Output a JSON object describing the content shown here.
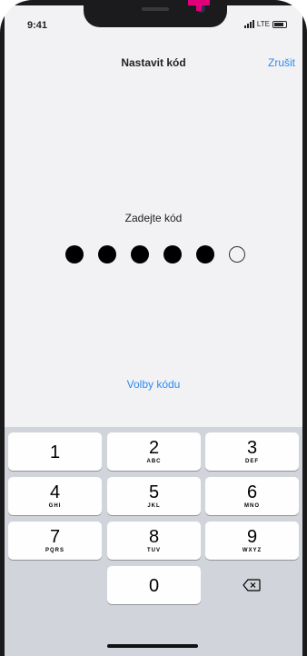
{
  "status_bar": {
    "time": "9:41",
    "network": "LTE"
  },
  "navbar": {
    "title": "Nastavit kód",
    "cancel": "Zrušit"
  },
  "passcode": {
    "prompt": "Zadejte kód",
    "length": 6,
    "filled": 5
  },
  "options_link": "Volby kódu",
  "keypad": {
    "keys": [
      {
        "num": "1",
        "letters": ""
      },
      {
        "num": "2",
        "letters": "ABC"
      },
      {
        "num": "3",
        "letters": "DEF"
      },
      {
        "num": "4",
        "letters": "GHI"
      },
      {
        "num": "5",
        "letters": "JKL"
      },
      {
        "num": "6",
        "letters": "MNO"
      },
      {
        "num": "7",
        "letters": "PQRS"
      },
      {
        "num": "8",
        "letters": "TUV"
      },
      {
        "num": "9",
        "letters": "WXYZ"
      },
      {
        "num": "0",
        "letters": ""
      }
    ],
    "delete_icon": "backspace-icon"
  },
  "colors": {
    "accent": "#2a8cf0",
    "marker": "#e2007a",
    "keypad_bg": "#d1d4da",
    "screen_bg": "#f2f2f5"
  }
}
